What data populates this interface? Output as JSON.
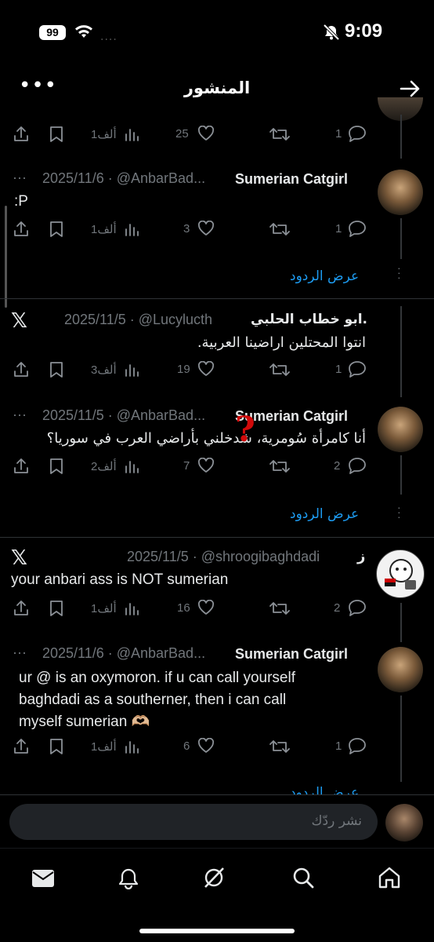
{
  "status_bar": {
    "battery": "99",
    "time": "9:09",
    "signal": "····"
  },
  "header": {
    "title": "المنشور",
    "more": "•••"
  },
  "tweets": [
    {
      "reply": "1",
      "retweet": "",
      "like": "25",
      "views": "1ألف"
    },
    {
      "name": "Sumerian Catgirl",
      "handle_date": "2025/11/6 · @AnbarBad...",
      "more": "···",
      "text": ":P",
      "reply": "1",
      "like": "3",
      "views": "1ألف",
      "show_replies": "عرض الردود"
    },
    {
      "name": "ابو خطاب الحلبي.",
      "handle_date": "2025/11/5 · @Lucylucth",
      "text": "انتوا المحتلين اراضينا العربية.",
      "reply": "1",
      "like": "19",
      "views": "3ألف"
    },
    {
      "name": "Sumerian Catgirl",
      "handle_date": "2025/11/5 · @AnbarBad...",
      "more": "···",
      "text": "أنا كامرأة سُومرية، شدخلني بأراضي العرب في سوريا؟",
      "reply": "2",
      "like": "7",
      "views": "2ألف",
      "show_replies": "عرض الردود"
    },
    {
      "name": "ز",
      "handle_date": "2025/11/5 · @shroogibaghdadi",
      "text": "your anbari ass is NOT sumerian",
      "reply": "2",
      "like": "16",
      "views": "1ألف"
    },
    {
      "name": "Sumerian Catgirl",
      "handle_date": "2025/11/6 · @AnbarBad...",
      "more": "···",
      "text_lines": [
        "ur @ is an oxymoron. if u can call yourself",
        "baghdadi as a southerner, then i can call",
        "myself sumerian 🫶🏼"
      ],
      "reply": "1",
      "like": "6",
      "views": "1ألف",
      "show_replies": "عرض الردود"
    }
  ],
  "annotation": {
    "mark": "?"
  },
  "compose": {
    "placeholder": "نشر ردّك"
  },
  "tabs": [
    "mail-icon",
    "bell-icon",
    "grok-icon",
    "search-icon",
    "home-icon"
  ],
  "colors": {
    "accent": "#1d9bf0",
    "muted": "#71767b",
    "background": "#000000"
  }
}
